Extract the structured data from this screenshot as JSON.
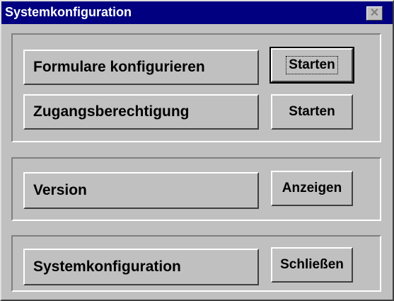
{
  "window": {
    "title": "Systemkonfiguration"
  },
  "icons": {
    "close": "close-icon"
  },
  "rows": [
    {
      "label": "Formulare konfigurieren",
      "button": "Starten"
    },
    {
      "label": "Zugangsberechtigung",
      "button": "Starten"
    },
    {
      "label": "Version",
      "button": "Anzeigen"
    },
    {
      "label": "Systemkonfiguration",
      "button": "Schließen"
    }
  ],
  "colors": {
    "titlebar": "#000080",
    "face": "#c0c0c0"
  }
}
